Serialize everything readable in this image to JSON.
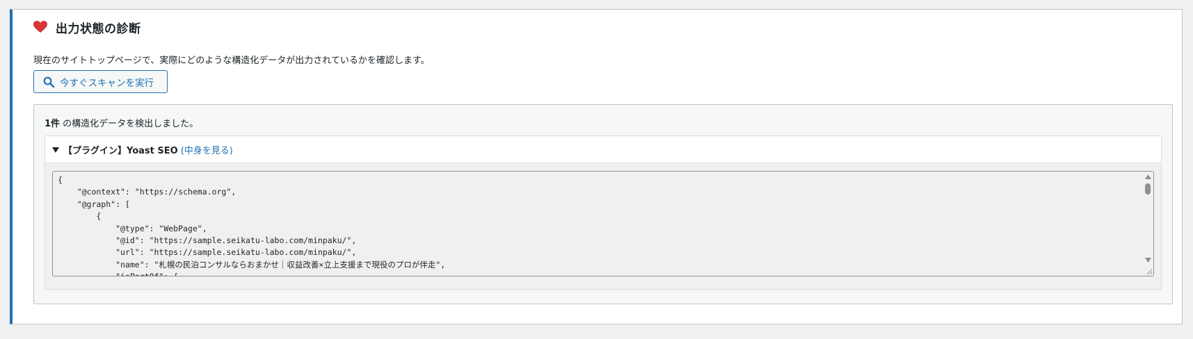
{
  "panel": {
    "title": "出力状態の診断",
    "description": "現在のサイトトップページで、実際にどのような構造化データが出力されているかを確認します。",
    "scan_button_label": "今すぐスキャンを実行",
    "icons": {
      "title": "heart-icon",
      "scan": "search-icon"
    },
    "colors": {
      "accent": "#2271b1",
      "heart": "#d63638"
    }
  },
  "results": {
    "count": "1件",
    "found_suffix": " の構造化データを検出しました。",
    "items": [
      {
        "label": "【プラグイン】Yoast SEO",
        "view_link": "(中身を見る)",
        "code": "{\n    \"@context\": \"https://schema.org\",\n    \"@graph\": [\n        {\n            \"@type\": \"WebPage\",\n            \"@id\": \"https://sample.seikatu-labo.com/minpaku/\",\n            \"url\": \"https://sample.seikatu-labo.com/minpaku/\",\n            \"name\": \"札幌の民泊コンサルならおまかせ｜収益改善×立上支援まで現役のプロが伴走\",\n            \"isPartOf\": {"
      }
    ]
  }
}
